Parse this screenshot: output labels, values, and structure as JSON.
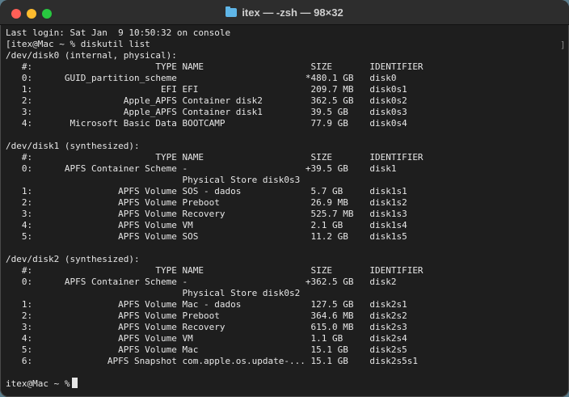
{
  "window": {
    "title": "itex — -zsh — 98×32",
    "folder_icon": "folder-icon"
  },
  "terminal": {
    "lines": [
      "Last login: Sat Jan  9 10:50:32 on console",
      "[itex@Mac ~ % diskutil list",
      "/dev/disk0 (internal, physical):",
      "   #:                       TYPE NAME                    SIZE       IDENTIFIER",
      "   0:      GUID_partition_scheme                        *480.1 GB   disk0",
      "   1:                        EFI EFI                     209.7 MB   disk0s1",
      "   2:                 Apple_APFS Container disk2         362.5 GB   disk0s2",
      "   3:                 Apple_APFS Container disk1         39.5 GB    disk0s3",
      "   4:       Microsoft Basic Data BOOTCAMP                77.9 GB    disk0s4",
      "",
      "/dev/disk1 (synthesized):",
      "   #:                       TYPE NAME                    SIZE       IDENTIFIER",
      "   0:      APFS Container Scheme -                      +39.5 GB    disk1",
      "                                 Physical Store disk0s3",
      "   1:                APFS Volume SOS - dados             5.7 GB     disk1s1",
      "   2:                APFS Volume Preboot                 26.9 MB    disk1s2",
      "   3:                APFS Volume Recovery                525.7 MB   disk1s3",
      "   4:                APFS Volume VM                      2.1 GB     disk1s4",
      "   5:                APFS Volume SOS                     11.2 GB    disk1s5",
      "",
      "/dev/disk2 (synthesized):",
      "   #:                       TYPE NAME                    SIZE       IDENTIFIER",
      "   0:      APFS Container Scheme -                      +362.5 GB   disk2",
      "                                 Physical Store disk0s2",
      "   1:                APFS Volume Mac - dados             127.5 GB   disk2s1",
      "   2:                APFS Volume Preboot                 364.6 MB   disk2s2",
      "   3:                APFS Volume Recovery                615.0 MB   disk2s3",
      "   4:                APFS Volume VM                      1.1 GB     disk2s4",
      "   5:                APFS Volume Mac                     15.1 GB    disk2s5",
      "   6:              APFS Snapshot com.apple.os.update-... 15.1 GB    disk2s5s1",
      ""
    ],
    "prompt": "itex@Mac ~ %",
    "scroll_bracket": "]"
  },
  "colors": {
    "background": "#1e1e1e",
    "titlebar": "#2d2d2d",
    "text": "#e6e6e6",
    "close": "#ff5f57",
    "minimize": "#febc2e",
    "zoom": "#28c840"
  }
}
